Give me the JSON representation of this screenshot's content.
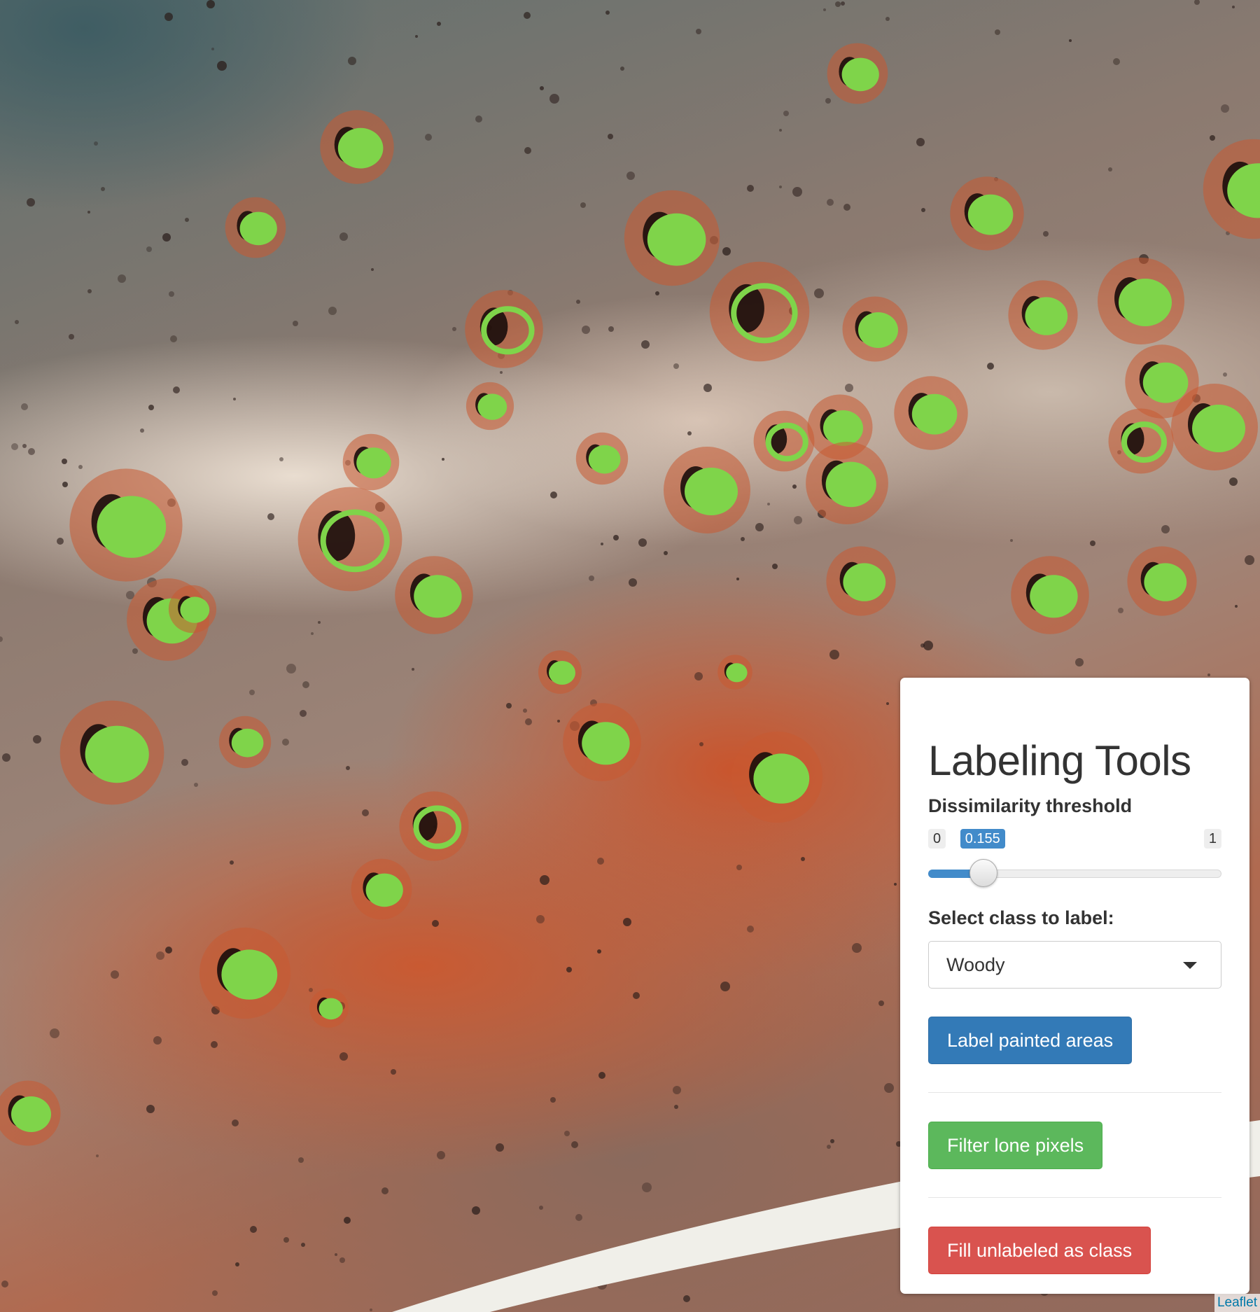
{
  "panel": {
    "title": "Labeling Tools",
    "threshold": {
      "label": "Dissimilarity threshold",
      "min_label": "0",
      "max_label": "1",
      "value_label": "0.155",
      "value": 0.155,
      "min": 0,
      "max": 1
    },
    "class_select": {
      "label": "Select class to label:",
      "selected": "Woody"
    },
    "buttons": {
      "label_painted": "Label painted areas",
      "filter_lone": "Filter lone pixels",
      "fill_unlabeled": "Fill unlabeled as class"
    }
  },
  "map": {
    "attribution": "Leaflet",
    "colors": {
      "label_overlay": "#7fd44a",
      "bare_ground": "#c95a32",
      "vegetation_dark": "#1a0d0b"
    }
  },
  "colors": {
    "primary": "#337ab7",
    "success": "#5cb85c",
    "danger": "#d9534f",
    "slider_fill": "#428bca"
  }
}
